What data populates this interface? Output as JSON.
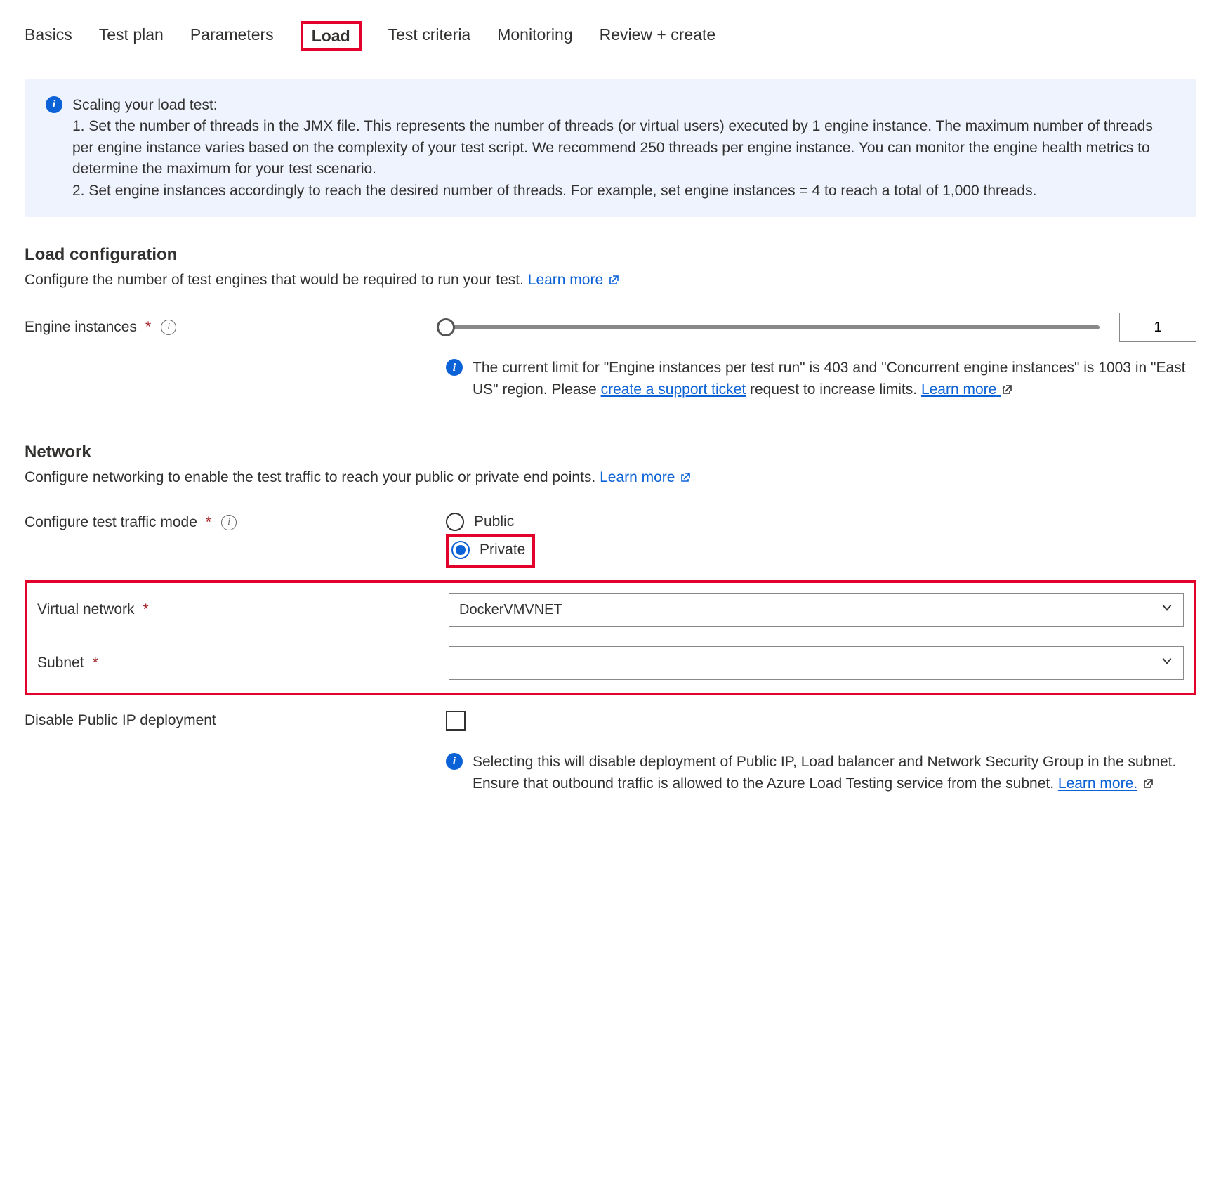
{
  "tabs": {
    "basics": "Basics",
    "testplan": "Test plan",
    "parameters": "Parameters",
    "load": "Load",
    "criteria": "Test criteria",
    "monitoring": "Monitoring",
    "review": "Review + create"
  },
  "infobox": {
    "title": "Scaling your load test:",
    "body": "1. Set the number of threads in the JMX file. This represents the number of threads (or virtual users) executed by 1 engine instance. The maximum number of threads per engine instance varies based on the complexity of your test script. We recommend 250 threads per engine instance. You can monitor the engine health metrics to determine the maximum for your test scenario.\n2. Set engine instances accordingly to reach the desired number of threads. For example, set engine instances = 4 to reach a total of 1,000 threads."
  },
  "loadcfg": {
    "heading": "Load configuration",
    "sub": "Configure the number of test engines that would be required to run your test. ",
    "learn": "Learn more",
    "engine_label": "Engine instances",
    "engine_value": "1",
    "limit_pre": "The current limit for \"Engine instances per test run\" is 403 and \"Concurrent engine instances\" is 1003 in \"East US\" region. Please ",
    "ticket": "create a support ticket",
    "limit_post": " request to increase limits. ",
    "learn2": "Learn more"
  },
  "network": {
    "heading": "Network",
    "sub": "Configure networking to enable the test traffic to reach your public or private end points. ",
    "learn": "Learn more",
    "mode_label": "Configure test traffic mode",
    "public": "Public",
    "private": "Private",
    "vnet_label": "Virtual network",
    "vnet_value": "DockerVMVNET",
    "subnet_label": "Subnet",
    "subnet_value": "",
    "pubip_label": "Disable Public IP deployment",
    "pubip_info": "Selecting this will disable deployment of Public IP, Load balancer and Network Security Group in the subnet. Ensure that outbound traffic is allowed to the Azure Load Testing service from the subnet. ",
    "pubip_learn": "Learn more."
  }
}
